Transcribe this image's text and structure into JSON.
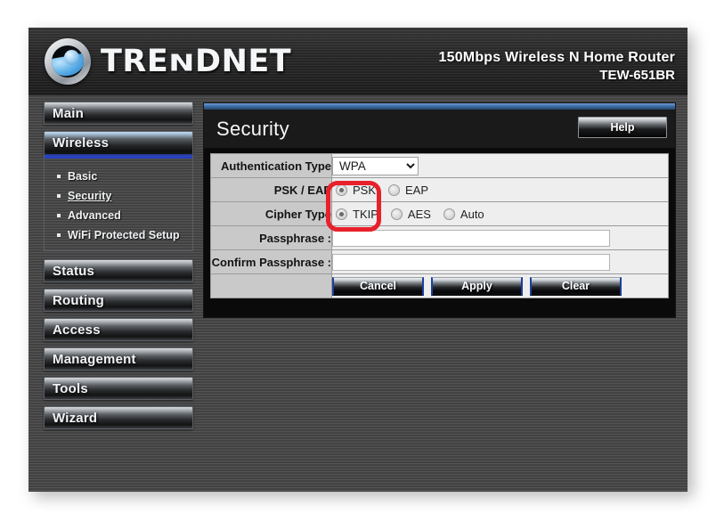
{
  "header": {
    "brand_text_1": "TRE",
    "brand_text_n_lower": "N",
    "brand_text_2": "D",
    "brand_text_3": "NET",
    "brand_full": "TRENDnet",
    "model_line1": "150Mbps Wireless N Home Router",
    "model_line2": "TEW-651BR",
    "logo_icon": "trendnet-globe-logo"
  },
  "sidebar": {
    "items": [
      {
        "label": "Main",
        "active": false
      },
      {
        "label": "Wireless",
        "active": true
      },
      {
        "label": "Status",
        "active": false
      },
      {
        "label": "Routing",
        "active": false
      },
      {
        "label": "Access",
        "active": false
      },
      {
        "label": "Management",
        "active": false
      },
      {
        "label": "Tools",
        "active": false
      },
      {
        "label": "Wizard",
        "active": false
      }
    ],
    "submenu": [
      {
        "label": "Basic",
        "current": false
      },
      {
        "label": "Security",
        "current": true
      },
      {
        "label": "Advanced",
        "current": false
      },
      {
        "label": "WiFi Protected Setup",
        "current": false
      }
    ]
  },
  "content": {
    "title": "Security",
    "help_label": "Help",
    "rows": {
      "auth_type": {
        "label": "Authentication Type",
        "selected": "WPA",
        "options": [
          "WPA"
        ]
      },
      "psk_eap": {
        "label": "PSK / EAP",
        "options": [
          {
            "label": "PSK",
            "selected": true
          },
          {
            "label": "EAP",
            "selected": false
          }
        ]
      },
      "cipher_type": {
        "label": "Cipher Type",
        "options": [
          {
            "label": "TKIP",
            "selected": true
          },
          {
            "label": "AES",
            "selected": false
          },
          {
            "label": "Auto",
            "selected": false
          }
        ]
      },
      "passphrase": {
        "label": "Passphrase :",
        "value": "",
        "placeholder": ""
      },
      "confirm_passphrase": {
        "label": "Confirm Passphrase :",
        "value": "",
        "placeholder": ""
      }
    },
    "buttons": [
      {
        "label": "Cancel"
      },
      {
        "label": "Apply"
      },
      {
        "label": "Clear"
      }
    ]
  },
  "annotation": {
    "name": "red-highlight-box",
    "color": "#e8202a"
  }
}
